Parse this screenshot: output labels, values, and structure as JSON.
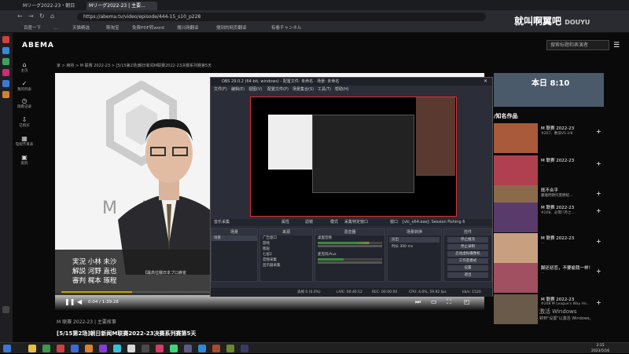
{
  "browser": {
    "tabs": [
      "Mリーグ2022-23・朝日...",
      "Mリーグ2022-23 | 主要..."
    ],
    "url": "https://abema.tv/video/episode/444-15_s10_p228",
    "bookmarks": [
      "百度一下",
      "...",
      "天猫精选",
      "斯淘宝",
      "免费PDF转word",
      "搜兴网翻译",
      "搜到的网页翻译",
      "有看チャンネル"
    ]
  },
  "overlay": {
    "streamer": "就叫啊翼吧",
    "platform": "DOUYU"
  },
  "site": {
    "logo": "ABEMA",
    "search_placeholder": "搜索标题和表演者",
    "left_nav": [
      {
        "icon": "home-icon",
        "label": "主页"
      },
      {
        "icon": "check-icon",
        "label": "我的列表"
      },
      {
        "icon": "history-icon",
        "label": "观看记录"
      },
      {
        "icon": "download-icon",
        "label": "已购买"
      },
      {
        "icon": "calendar-icon",
        "label": "电视节目表"
      },
      {
        "icon": "grid-icon",
        "label": "类别"
      }
    ],
    "breadcrumb": "家 > 麻将 > M 联赛 2022-23 > [5/15第2场]朝日新闻M联赛2022-23决赛系列赛第5天",
    "video": {
      "caption_lines": [
        "実況 小林 未沙",
        "解説 河野 直也",
        "審判 梶本 琢程"
      ],
      "caption_side": "【最高位戦日本プロ麻雀",
      "logo_text": "M I",
      "time": "0:04 / 1:39:28",
      "progress": 0.17
    },
    "episode_series": "M 联赛 2022-23 | 主要故事",
    "episode_title": "[5/15第2场]朝日新闻M联赛2022-23决赛系列赛第5天",
    "right": {
      "banner_text": "本日 8:10",
      "title": "/知名作品",
      "items": [
        {
          "title": "M 联赛 2022-23",
          "sub": "#207、敷浪VS 2/8"
        },
        {
          "title": "M 联赛 2022-23",
          "sub": "..."
        },
        {
          "title": "既不合乎",
          "sub": "麗雅問朝伝夏節紹..."
        },
        {
          "title": "M 联赛 2022-23",
          "sub": "#208、必需!!月之..."
        },
        {
          "title": "M 联赛 2022-23",
          "sub": "..."
        },
        {
          "title": "脚还初恋，不要偷我一样！",
          "sub": "..."
        },
        {
          "title": "M 联赛 2022-23",
          "sub": "#208 M League's Way Ho..."
        }
      ]
    }
  },
  "obs": {
    "title": "OBS 29.0.2 (64-bit, windows) - 配置文件: 未命名 - 场景: 未命名",
    "menu": [
      "文件(F)",
      "编辑(E)",
      "视图(V)",
      "配置文件(P)",
      "场景集合(S)",
      "工具(T)",
      "帮助(H)"
    ],
    "bar_items": [
      "音乐采集",
      "属性",
      "滤镜",
      "模式",
      "采集特定窗口",
      "窗口",
      "[vlc_x64.exe]: Session Fishing 6"
    ],
    "docks": {
      "scenes": {
        "title": "场景",
        "items": [
          "场景"
        ]
      },
      "sources": {
        "title": "来源",
        "items": [
          "广告窗口",
          "游戏",
          "图层",
          "七层2",
          "音频采集",
          "显示器采集"
        ]
      },
      "mixer": {
        "title": "混音器",
        "items": [
          "桌面音频",
          "麦克风/Aux"
        ]
      },
      "transitions": {
        "title": "场景转换",
        "items": [
          "淡出",
          "时长 300 ms"
        ]
      },
      "controls": {
        "title": "控件",
        "items": [
          "停止推流",
          "停止录制",
          "启动虚拟摄像机",
          "工作室模式",
          "设置",
          "退出"
        ]
      }
    },
    "status": [
      "丢帧 0 (0.0%)",
      "LIVE: 00:40:12",
      "REC: 00:00:00",
      "CPU: 4.0%, 59.92 fps",
      "kb/s: 1520"
    ]
  },
  "watermark": [
    "激活 Windows",
    "转到\"设置\"以激活 Windows。"
  ],
  "clock": {
    "time": "2:15",
    "date": "2023/5/16"
  }
}
